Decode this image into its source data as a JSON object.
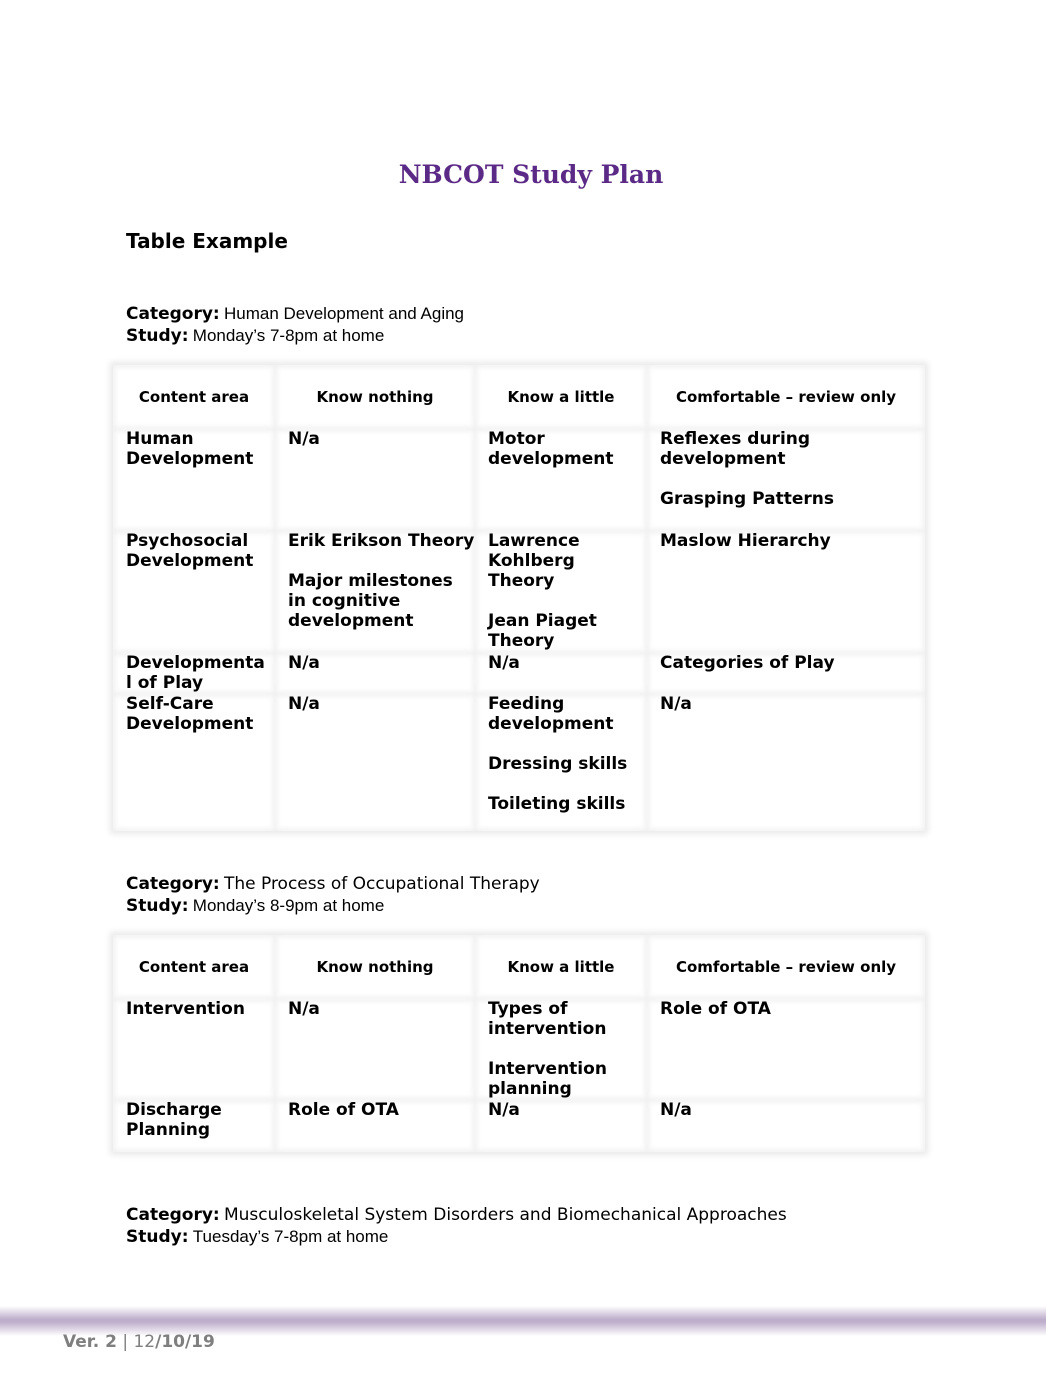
{
  "document": {
    "title": "NBCOT Study Plan",
    "subtitle": "Table Example",
    "category_label": "Category:",
    "study_label": "Study:",
    "sections": [
      {
        "category": "Human Development and Aging",
        "study": "Monday’s 7-8pm at home",
        "table": {
          "headers": [
            "Content area",
            "Know nothing",
            "Know a little",
            "Comfortable – review only"
          ],
          "rows": [
            {
              "content_area": "Human Development",
              "know_nothing": [
                "N/a"
              ],
              "know_a_little": [
                "Motor development"
              ],
              "comfortable": [
                "Reflexes during development",
                "Grasping Patterns"
              ]
            },
            {
              "content_area": "Psychosocial Development",
              "know_nothing": [
                "Erik Erikson Theory",
                "Major milestones in cognitive development"
              ],
              "know_a_little": [
                "Lawrence Kohlberg Theory",
                "Jean Piaget Theory"
              ],
              "comfortable": [
                "Maslow Hierarchy"
              ]
            },
            {
              "content_area": "Developmenta l  of Play",
              "know_nothing": [
                "N/a"
              ],
              "know_a_little": [
                "N/a"
              ],
              "comfortable": [
                "Categories of Play"
              ]
            },
            {
              "content_area": "Self-Care Development",
              "know_nothing": [
                "N/a"
              ],
              "know_a_little": [
                "Feeding development",
                "Dressing skills",
                "Toileting skills"
              ],
              "comfortable": [
                "N/a"
              ]
            }
          ]
        }
      },
      {
        "category": "The Process of Occupational Therapy",
        "study": "Monday’s 8-9pm at home",
        "table": {
          "headers": [
            "Content area",
            "Know nothing",
            "Know a little",
            "Comfortable – review only"
          ],
          "rows": [
            {
              "content_area": "Intervention",
              "know_nothing": [
                "N/a"
              ],
              "know_a_little": [
                "Types of intervention",
                "Intervention planning"
              ],
              "comfortable": [
                "Role of OTA"
              ]
            },
            {
              "content_area": "Discharge Planning",
              "know_nothing": [
                "Role of OTA"
              ],
              "know_a_little": [
                "N/a"
              ],
              "comfortable": [
                "N/a"
              ]
            }
          ]
        }
      },
      {
        "category": "Musculoskeletal System Disorders and Biomechanical Approaches",
        "study": "Tuesday’s 7-8pm at home"
      }
    ]
  },
  "footer": {
    "version": "Ver. 2",
    "separator": " | ",
    "date_prefix": "12",
    "date_rest": "/10/19"
  },
  "colors": {
    "title": "#5b2a86",
    "footer_text": "#7f7f7f",
    "footer_bar": "#b9a8c8"
  }
}
